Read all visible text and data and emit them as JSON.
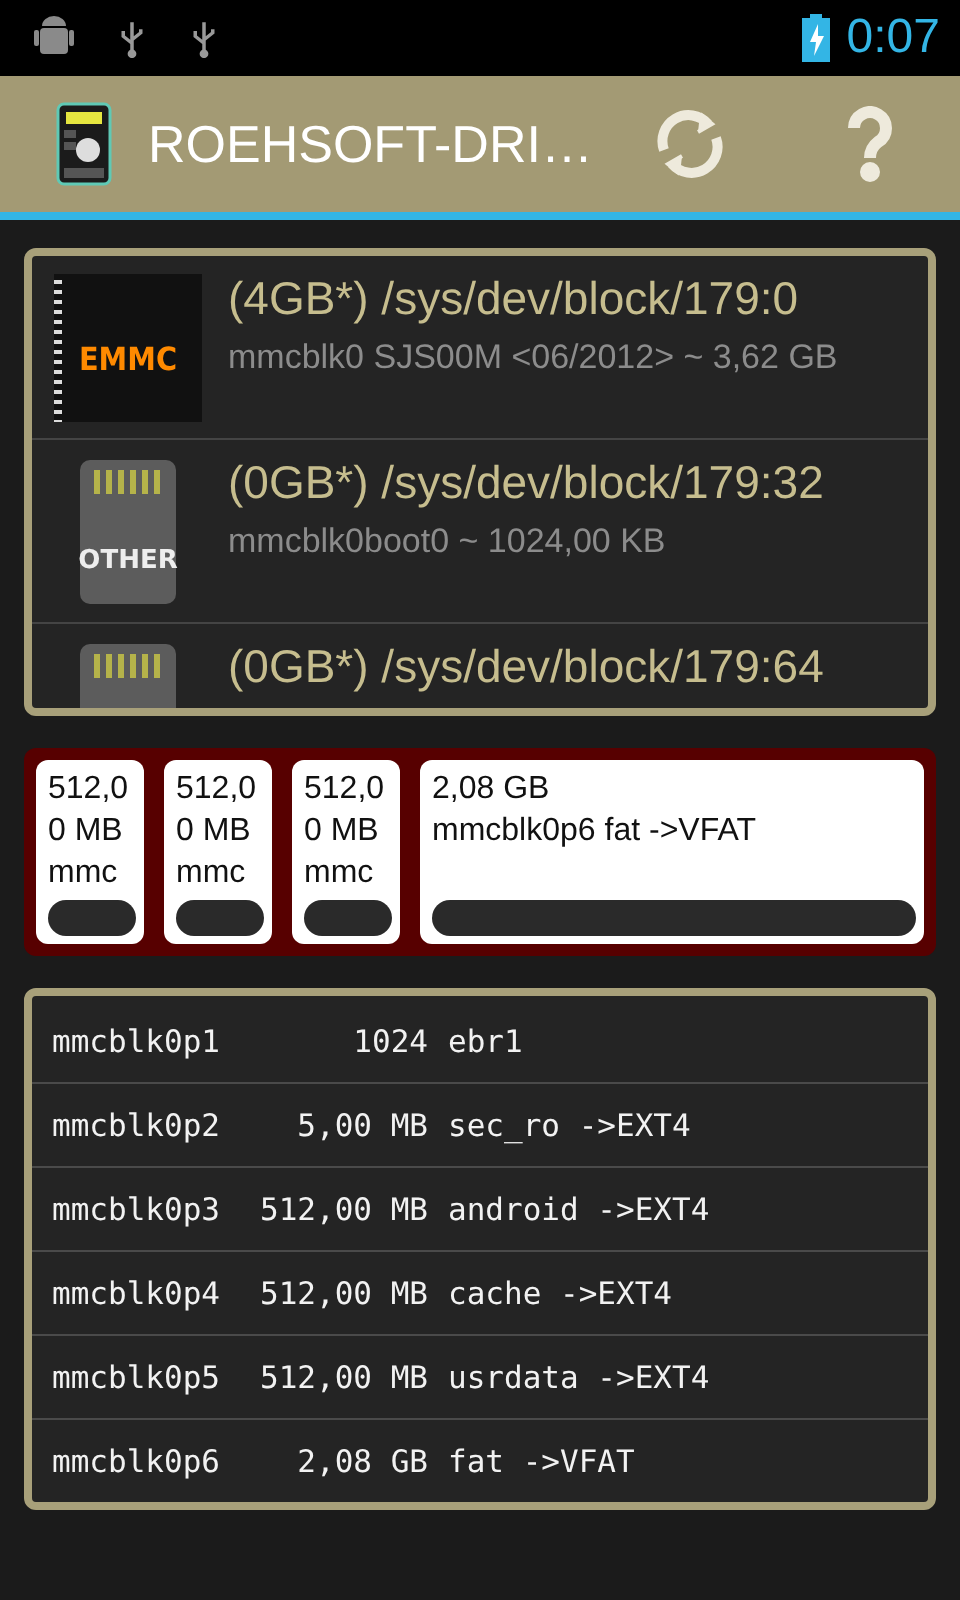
{
  "status_bar": {
    "time": "0:07"
  },
  "action_bar": {
    "title": "ROEHSOFT-DRI…"
  },
  "devices": [
    {
      "kind": "emmc",
      "icon_label": "EMMC",
      "title": "(4GB*) /sys/dev/block/179:0",
      "subtitle": "mmcblk0 SJS00M <06/2012>  ~ 3,62 GB"
    },
    {
      "kind": "other",
      "icon_label": "OTHER",
      "title": "(0GB*) /sys/dev/block/179:32",
      "subtitle": "mmcblk0boot0  ~ 1024,00 KB"
    },
    {
      "kind": "other",
      "title": "(0GB*) /sys/dev/block/179:64"
    }
  ],
  "partition_cards": [
    {
      "lines": [
        "512,0",
        "0 MB",
        "mmc"
      ]
    },
    {
      "lines": [
        "512,0",
        "0 MB",
        "mmc"
      ]
    },
    {
      "lines": [
        "512,0",
        "0 MB",
        "mmc"
      ]
    },
    {
      "lines": [
        "2,08 GB",
        "mmcblk0p6 fat ->VFAT"
      ]
    }
  ],
  "partitions": [
    {
      "name": "mmcblk0p1",
      "size": "1024",
      "label": "ebr1"
    },
    {
      "name": "mmcblk0p2",
      "size": "5,00 MB",
      "label": "sec_ro ->EXT4"
    },
    {
      "name": "mmcblk0p3",
      "size": "512,00 MB",
      "label": "android ->EXT4"
    },
    {
      "name": "mmcblk0p4",
      "size": "512,00 MB",
      "label": "cache ->EXT4"
    },
    {
      "name": "mmcblk0p5",
      "size": "512,00 MB",
      "label": "usrdata ->EXT4"
    },
    {
      "name": "mmcblk0p6",
      "size": "2,08 GB",
      "label": "fat ->VFAT"
    }
  ]
}
